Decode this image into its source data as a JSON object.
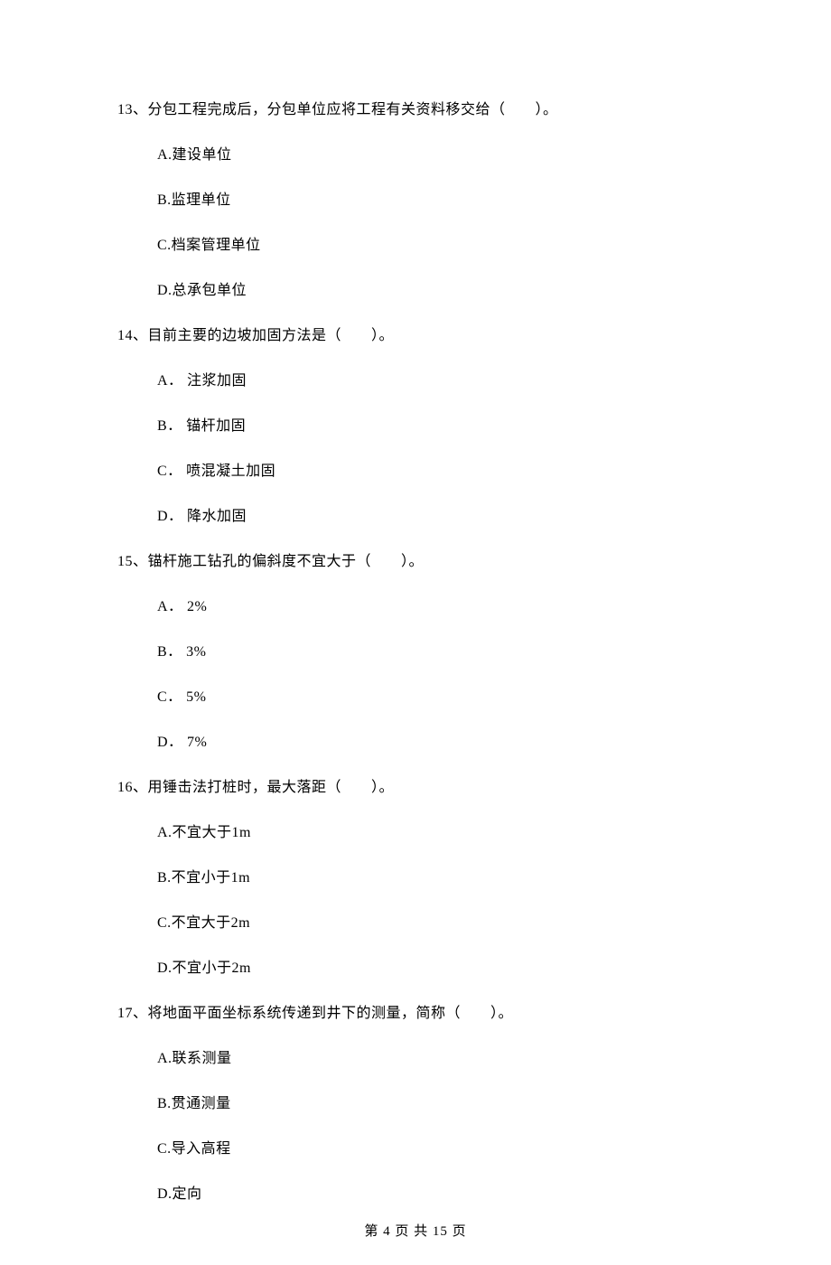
{
  "questions": [
    {
      "number": "13、",
      "stem": "分包工程完成后，分包单位应将工程有关资料移交给（　　）。",
      "options": [
        "A.建设单位",
        "B.监理单位",
        "C.档案管理单位",
        "D.总承包单位"
      ]
    },
    {
      "number": "14、",
      "stem": "目前主要的边坡加固方法是（　　）。",
      "options": [
        "A． 注浆加固",
        "B． 锚杆加固",
        "C． 喷混凝土加固",
        "D． 降水加固"
      ]
    },
    {
      "number": "15、",
      "stem": "锚杆施工钻孔的偏斜度不宜大于（　　）。",
      "options": [
        "A． 2%",
        "B． 3%",
        "C． 5%",
        "D． 7%"
      ]
    },
    {
      "number": "16、",
      "stem": "用锤击法打桩时，最大落距（　　）。",
      "options": [
        "A.不宜大于1m",
        "B.不宜小于1m",
        "C.不宜大于2m",
        "D.不宜小于2m"
      ]
    },
    {
      "number": "17、",
      "stem": "将地面平面坐标系统传递到井下的测量，简称（　　）。",
      "options": [
        "A.联系测量",
        "B.贯通测量",
        "C.导入高程",
        "D.定向"
      ]
    }
  ],
  "footer": "第 4 页 共 15 页"
}
